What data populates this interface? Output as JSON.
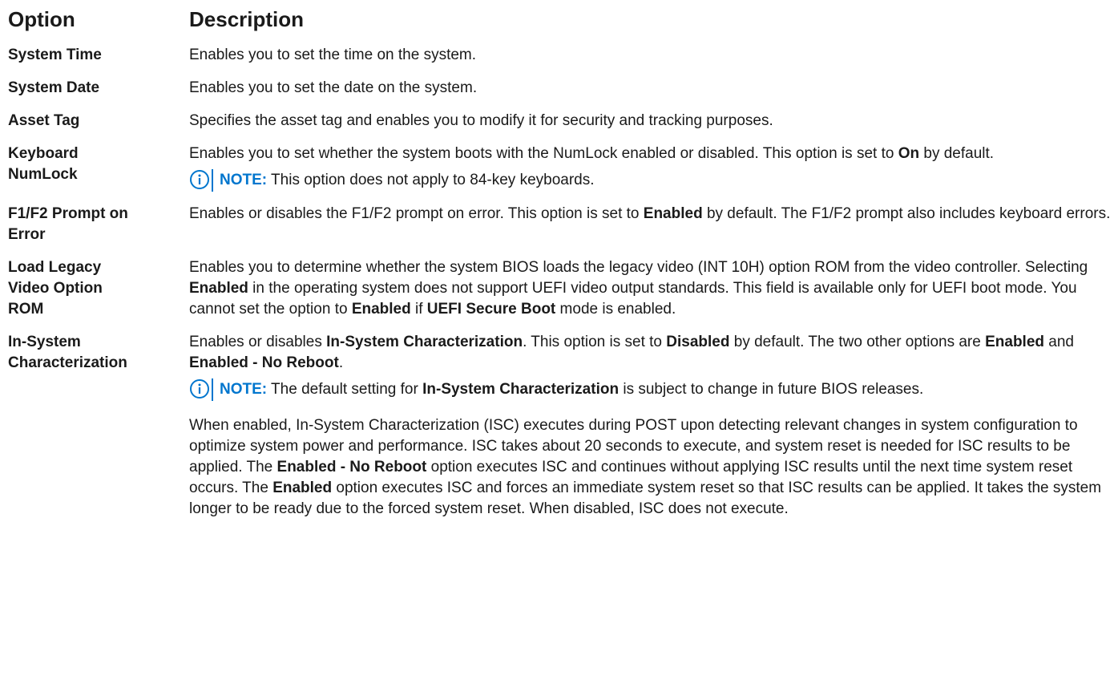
{
  "header": {
    "option": "Option",
    "description": "Description"
  },
  "rows": [
    {
      "option": "System Time",
      "text": "Enables you to set the time on the system."
    },
    {
      "option": "System Date",
      "text": "Enables you to set the date on the system."
    },
    {
      "option": "Asset Tag",
      "text": "Specifies the asset tag and enables you to modify it for security and tracking purposes."
    },
    {
      "option_line1": "Keyboard",
      "option_line2": "NumLock",
      "text_a": "Enables you to set whether the system boots with the NumLock enabled or disabled. This option is set to ",
      "bold_a": "On",
      "text_b": " by default.",
      "note_label": "NOTE:",
      "note_text": " This option does not apply to 84-key keyboards."
    },
    {
      "option_line1": "F1/F2 Prompt on",
      "option_line2": "Error",
      "text_a": "Enables or disables the F1/F2 prompt on error. This option is set to ",
      "bold_a": "Enabled",
      "text_b": " by default. The F1/F2 prompt also includes keyboard errors."
    },
    {
      "option_line1": "Load Legacy",
      "option_line2": "Video Option",
      "option_line3": "ROM",
      "text_a": "Enables you to determine whether the system BIOS loads the legacy video (INT 10H) option ROM from the video controller. Selecting ",
      "bold_a": "Enabled",
      "text_b": " in the operating system does not support UEFI video output standards. This field is available only for UEFI boot mode. You cannot set the option to ",
      "bold_b": "Enabled",
      "text_c": " if ",
      "bold_c": "UEFI Secure Boot",
      "text_d": " mode is enabled."
    },
    {
      "option_line1": "In-System",
      "option_line2": "Characterization",
      "text_a": "Enables or disables ",
      "bold_a": "In-System Characterization",
      "text_b": ". This option is set to ",
      "bold_b": "Disabled",
      "text_c": " by default. The two other options are ",
      "bold_c": "Enabled",
      "text_d": " and ",
      "bold_d": "Enabled - No Reboot",
      "text_e": ".",
      "note_label": "NOTE:",
      "note_text_a": " The default setting for ",
      "note_bold": "In-System Characterization",
      "note_text_b": " is subject to change in future BIOS releases.",
      "p2_a": "When enabled, In-System Characterization (ISC) executes during POST upon detecting relevant changes in system configuration to optimize system power and performance. ISC takes about 20 seconds to execute, and system reset is needed for ISC results to be applied. The ",
      "p2_bold_a": "Enabled - No Reboot",
      "p2_b": " option executes ISC and continues without applying ISC results until the next time system reset occurs. The ",
      "p2_bold_b": "Enabled",
      "p2_c": " option executes ISC and forces an immediate system reset so that ISC results can be applied. It takes the system longer to be ready due to the forced system reset. When disabled, ISC does not execute."
    }
  ],
  "icons": {
    "note": "info-circle-icon"
  },
  "colors": {
    "accent": "#0076ce",
    "text": "#1a1a1a"
  }
}
